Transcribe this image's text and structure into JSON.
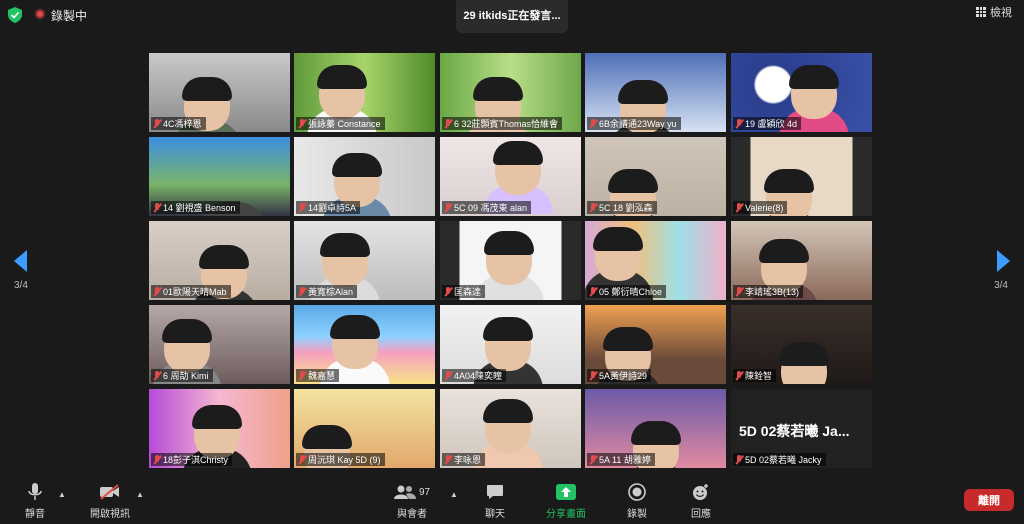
{
  "topbar": {
    "recording_label": "錄製中",
    "active_speaker": "29 itkids正在發言...",
    "view_label": "檢視"
  },
  "pager": {
    "left": "3/4",
    "right": "3/4"
  },
  "participants": [
    {
      "name": "4C馮梓恩"
    },
    {
      "name": "張詠蓁 Constance"
    },
    {
      "name": "6 32莊顥賓Thomas恰維會"
    },
    {
      "name": "6B余譜通23Way yu"
    },
    {
      "name": "19 盧穎欣 4d"
    },
    {
      "name": "14 劉視盛 Benson"
    },
    {
      "name": "14劉卓詩5A"
    },
    {
      "name": "5C 09 馮茂東 alan"
    },
    {
      "name": "5C 18 劉泓森"
    },
    {
      "name": "Valerie(8)"
    },
    {
      "name": "01歐陽天晴Mab"
    },
    {
      "name": "黃寬棕Alan"
    },
    {
      "name": "匡森達"
    },
    {
      "name": "05 鄭衍晴Chloe"
    },
    {
      "name": "李靖瑤3B(13)"
    },
    {
      "name": "6 周劼 Kimi"
    },
    {
      "name": "魏嘉慧"
    },
    {
      "name": "4A04陳奕瞳"
    },
    {
      "name": "5A黃伊詩29"
    },
    {
      "name": "陳銓智"
    },
    {
      "name": "18彭子淇Christy"
    },
    {
      "name": "周沅琪 Kay 5D (9)"
    },
    {
      "name": "李咏恩"
    },
    {
      "name": "5A 11 胡雅婷"
    },
    {
      "name": "5D 02蔡若曦 Jacky",
      "display_text": "5D 02蔡若曦 Ja..."
    }
  ],
  "toolbar": {
    "mute": "靜音",
    "start_video": "開啟視訊",
    "participants": "與會者",
    "participants_count": "97",
    "chat": "聊天",
    "share_screen": "分享畫面",
    "record": "錄製",
    "reactions": "回應",
    "leave": "離開"
  },
  "colors": {
    "accent_blue": "#3a9dff",
    "share_green": "#23c264",
    "leave_red": "#c62a2a",
    "muted_red": "#e34b4b"
  }
}
